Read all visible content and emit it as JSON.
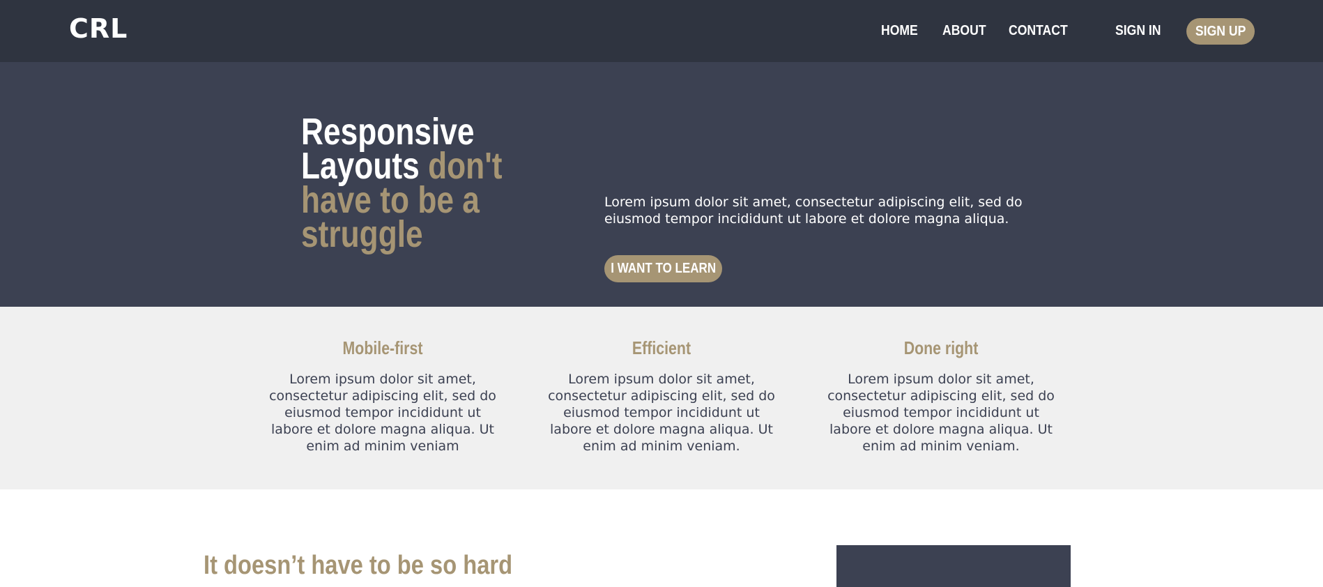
{
  "brand": {
    "logo": "CRL"
  },
  "nav": {
    "items": [
      {
        "label": "HOME"
      },
      {
        "label": "ABOUT"
      },
      {
        "label": "CONTACT"
      }
    ],
    "sign_in": "SIGN IN",
    "sign_up": "SIGN UP"
  },
  "hero": {
    "title_white_1": "Responsive",
    "title_white_2": "Layouts",
    "title_accent": "don't have to be a struggle",
    "text": "Lorem ipsum dolor sit amet, consectetur adipiscing elit, sed do eiusmod tempor incididunt ut labore et dolore magna aliqua.",
    "cta": "I WANT TO LEARN"
  },
  "features": [
    {
      "title": "Mobile-first",
      "text": "Lorem ipsum dolor sit amet, consectetur adipiscing elit, sed do eiusmod tempor incididunt ut labore et dolore magna aliqua. Ut enim ad minim veniam"
    },
    {
      "title": "Efficient",
      "text": "Lorem ipsum dolor sit amet, consectetur adipiscing elit, sed do eiusmod tempor incididunt ut labore et dolore magna aliqua. Ut enim ad minim veniam."
    },
    {
      "title": "Done right",
      "text": "Lorem ipsum dolor sit amet, consectetur adipiscing elit, sed do eiusmod tempor incididunt ut labore et dolore magna aliqua. Ut enim ad minim veniam."
    }
  ],
  "section2": {
    "title": "It doesn’t have to be so hard"
  },
  "colors": {
    "topbar": "#2f3440",
    "hero": "#3c4152",
    "accent": "#a69574",
    "features_bg": "#f0f0f0"
  }
}
